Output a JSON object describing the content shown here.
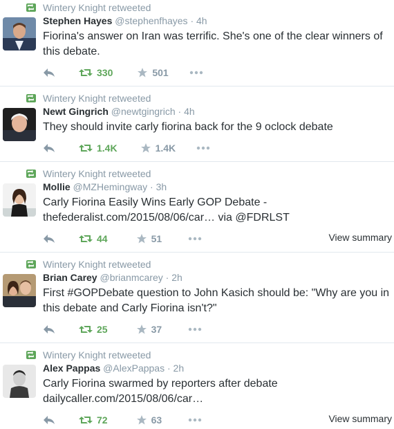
{
  "colors": {
    "retweet_green": "#5ea65a",
    "muted_gray": "#8899a6",
    "text_dark": "#292f33",
    "divider": "#e1e8ed"
  },
  "tweets": [
    {
      "retweeted_by": "Wintery Knight retweeted",
      "name": "Stephen Hayes",
      "handle": "@stephenfhayes",
      "dot": "·",
      "time": "4h",
      "text": "Fiorina's answer on Iran was terrific. She's one of the clear winners of this debate.",
      "retweets": "330",
      "favorites": "501",
      "summary": ""
    },
    {
      "retweeted_by": "Wintery Knight retweeted",
      "name": "Newt Gingrich",
      "handle": "@newtgingrich",
      "dot": "·",
      "time": "4h",
      "text": "They should invite carly fiorina back for the 9 oclock debate",
      "retweets": "1.4K",
      "favorites": "1.4K",
      "summary": ""
    },
    {
      "retweeted_by": "Wintery Knight retweeted",
      "name": "Mollie",
      "handle": "@MZHemingway",
      "dot": "·",
      "time": "3h",
      "text": "Carly Fiorina Easily Wins Early GOP Debate - thefederalist.com/2015/08/06/car… via @FDRLST",
      "retweets": "44",
      "favorites": "51",
      "summary": "View summary"
    },
    {
      "retweeted_by": "Wintery Knight retweeted",
      "name": "Brian Carey",
      "handle": "@brianmcarey",
      "dot": "·",
      "time": "2h",
      "text": "First #GOPDebate question to John Kasich should be: \"Why are you in this debate and Carly Fiorina isn't?\"",
      "retweets": "25",
      "favorites": "37",
      "summary": ""
    },
    {
      "retweeted_by": "Wintery Knight retweeted",
      "name": "Alex Pappas",
      "handle": "@AlexPappas",
      "dot": "·",
      "time": "2h",
      "text": "Carly Fiorina swarmed by reporters after debate dailycaller.com/2015/08/06/car…",
      "retweets": "72",
      "favorites": "63",
      "summary": "View summary"
    }
  ]
}
